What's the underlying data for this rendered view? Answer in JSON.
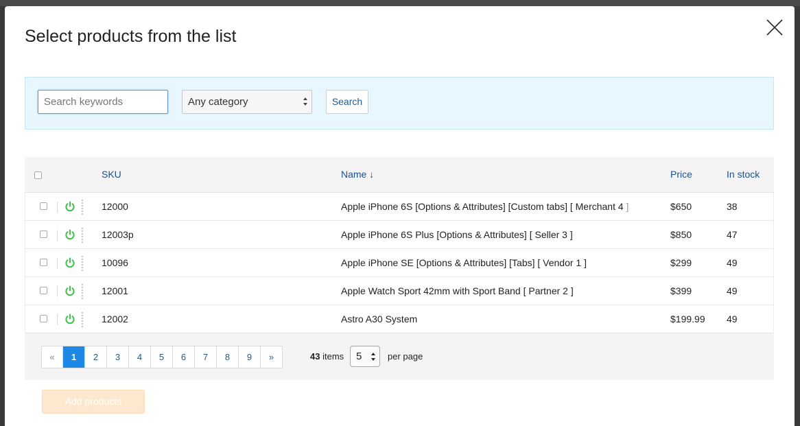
{
  "modal": {
    "title": "Select products from the list"
  },
  "search": {
    "keyword_placeholder": "Search keywords",
    "keyword_value": "",
    "category_selected": "Any category",
    "search_label": "Search"
  },
  "table": {
    "columns": {
      "sku": "SKU",
      "name": "Name ↓",
      "price": "Price",
      "stock": "In stock"
    },
    "rows": [
      {
        "sku": "12000",
        "name": "Apple iPhone 6S [Options & Attributes] [Custom tabs] [ Merchant 4",
        "name_tail": " ]",
        "price": "$650",
        "stock": "38"
      },
      {
        "sku": "12003p",
        "name": "Apple iPhone 6S Plus [Options & Attributes] [ Seller 3 ]",
        "name_tail": "",
        "price": "$850",
        "stock": "47"
      },
      {
        "sku": "10096",
        "name": "Apple iPhone SE [Options & Attributes] [Tabs] [ Vendor 1 ]",
        "name_tail": "",
        "price": "$299",
        "stock": "49"
      },
      {
        "sku": "12001",
        "name": "Apple Watch Sport 42mm with Sport Band [ Partner 2 ]",
        "name_tail": "",
        "price": "$399",
        "stock": "49"
      },
      {
        "sku": "12002",
        "name": "Astro A30 System",
        "name_tail": "",
        "price": "$199.99",
        "stock": "49"
      }
    ]
  },
  "pagination": {
    "prev": "«",
    "next": "»",
    "pages": [
      "1",
      "2",
      "3",
      "4",
      "5",
      "6",
      "7",
      "8",
      "9"
    ],
    "current": "1",
    "items_total": "43",
    "items_label": "items",
    "per_page_value": "5",
    "per_page_label": "per page"
  },
  "footer": {
    "add_products_label": "Add products"
  },
  "colors": {
    "accent": "#1e88e5",
    "link": "#1d4f8c",
    "power_on": "#3ec24a",
    "search_panel_bg": "#e7f6ff",
    "add_button_disabled": "#fde8cf"
  },
  "icons": {
    "close": "close-icon",
    "power": "power-icon",
    "sort": "sort-down-arrow"
  }
}
